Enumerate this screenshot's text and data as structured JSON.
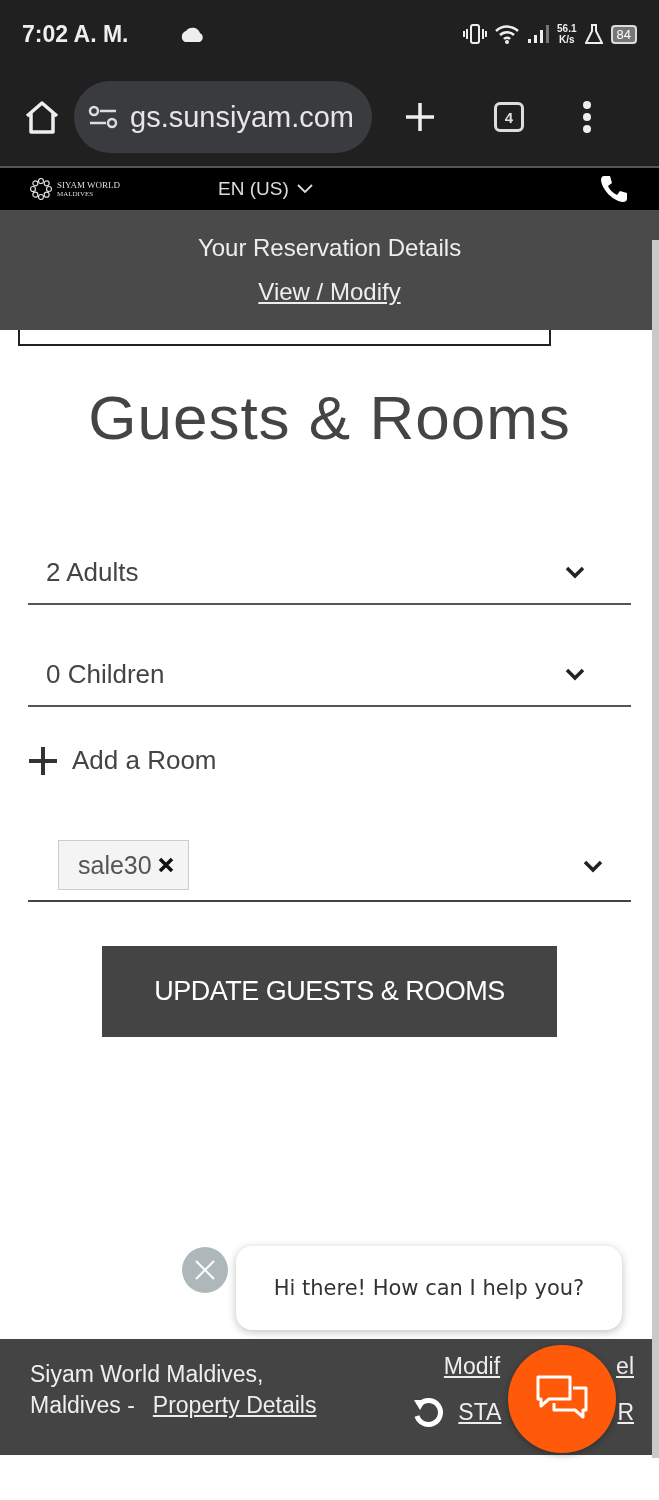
{
  "status_bar": {
    "time": "7:02 A. M.",
    "speed_value": "56.1",
    "speed_unit": "K/s",
    "battery": "84"
  },
  "browser": {
    "url": "gs.sunsiyam.com",
    "tab_count": "4"
  },
  "site_header": {
    "logo_name": "SIYAM WORLD",
    "logo_sub": "MALDIVES",
    "language": "EN (US)"
  },
  "reservation_bar": {
    "title": "Your Reservation Details",
    "link": "View / Modify"
  },
  "heading": "Guests & Rooms",
  "selects": [
    {
      "value": "2 Adults"
    },
    {
      "value": "0 Children"
    }
  ],
  "add_room": "Add a Room",
  "promo": {
    "tags": [
      "sale30"
    ]
  },
  "update_button": "UPDATE GUESTS & ROOMS",
  "chat": {
    "message": "Hi there! How can I help you?"
  },
  "footer": {
    "line1": "Siyam World Maldives,",
    "line2": "Maldives -",
    "property_link": "Property Details",
    "modify_link_start": "Modif",
    "modify_link_end": "el",
    "start_link_start": "STA",
    "start_link_end": "R"
  }
}
